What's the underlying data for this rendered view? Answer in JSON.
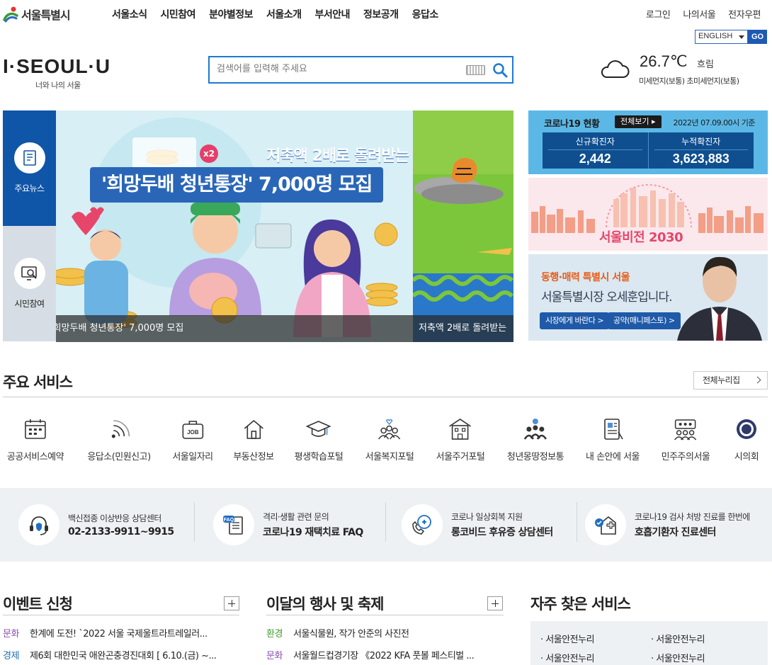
{
  "header": {
    "logo_text": "서울특별시",
    "gnb": [
      "서울소식",
      "시민참여",
      "분야별정보",
      "서울소개",
      "부서안내",
      "정보공개",
      "응답소"
    ],
    "util": [
      "로그인",
      "나의서울",
      "전자우편"
    ],
    "language": {
      "selected": "ENGLISH",
      "go_label": "GO"
    },
    "brand": {
      "main": "I·SEOUL·U",
      "sub": "너와 나의 서울"
    },
    "search": {
      "placeholder": "검색어를 입력해 주세요"
    },
    "weather": {
      "temp": "26.7℃",
      "sky": "흐림",
      "dust": "미세먼지(보통) 초미세먼지(보통)"
    }
  },
  "side_tabs": [
    {
      "label": "주요뉴스",
      "icon": "news-icon",
      "active": true
    },
    {
      "label": "시민참여",
      "icon": "monitor-search-icon",
      "active": false
    }
  ],
  "slides": [
    {
      "caption": "'희망두배 청년통장' 7,000명 모집",
      "headline_1": "저축액 2배로 돌려받는",
      "headline_2": "'희망두배 청년통장' 7,000명 모집",
      "badge": "x2"
    },
    {
      "caption": "저축액 2배로 돌려받는"
    }
  ],
  "covid": {
    "title": "코로나19 현황",
    "view_all": "전체보기 ▸",
    "date": "2022년 07.09.00시 기준",
    "new_label": "신규확진자",
    "new_value": "2,442",
    "total_label": "누적확진자",
    "total_value": "3,623,883"
  },
  "vision": {
    "label": "서울비전 2030"
  },
  "mayor": {
    "tagline": "동행·매력 특별시 서울",
    "title": "서울특별시장 오세훈입니다.",
    "btn1": "시장에게 바란다 >",
    "btn2": "공약(매니페스토) >"
  },
  "services": {
    "title": "주요 서비스",
    "all_label": "전체누리집",
    "items": [
      {
        "label": "공공서비스예약",
        "icon": "calendar-icon"
      },
      {
        "label": "응답소(민원신고)",
        "icon": "signal-icon"
      },
      {
        "label": "서울일자리",
        "icon": "job-bag-icon"
      },
      {
        "label": "부동산정보",
        "icon": "house-icon"
      },
      {
        "label": "평생학습포털",
        "icon": "graduation-cap-icon"
      },
      {
        "label": "서울복지포털",
        "icon": "people-heart-icon"
      },
      {
        "label": "서울주거포털",
        "icon": "apartment-icon"
      },
      {
        "label": "청년몽땅정보통",
        "icon": "youth-info-icon"
      },
      {
        "label": "내 손안에 서울",
        "icon": "mobile-news-icon"
      },
      {
        "label": "민주주의서울",
        "icon": "people-meeting-icon"
      },
      {
        "label": "시의회",
        "icon": "council-emblem-icon"
      }
    ]
  },
  "info_band": [
    {
      "line1": "백신접종 이상반응 상담센터",
      "line2": "02-2133-9911~9915",
      "icon": "headset-shield-icon"
    },
    {
      "line1": "격리·생활 관련 문의",
      "line2": "코로나19 재택치료 FAQ",
      "icon": "faq-document-icon"
    },
    {
      "line1": "코로나 일상회복 지원",
      "line2": "롱코비드 후유증 상담센터",
      "icon": "phone-medical-icon"
    },
    {
      "line1": "코로나19 검사 처방 진료를 한번에",
      "line2": "호흡기환자 진료센터",
      "icon": "clinic-check-icon"
    }
  ],
  "events": {
    "title": "이벤트 신청",
    "rows": [
      {
        "cat": "문화",
        "title": "한계에 도전! `2022 서울 국제울트라트레일러...",
        "cat_color": "#8a4fb3"
      },
      {
        "cat": "경제",
        "title": "제6회 대한민국 애완곤충경진대회 [ 6.10.(금) ~...",
        "cat_color": "#1d6fb3"
      }
    ]
  },
  "festivals": {
    "title": "이달의 행사 및 축제",
    "rows": [
      {
        "cat": "환경",
        "title": "서울식물원, 작가 안준의 사진전",
        "cat_color": "#3f9a2d"
      },
      {
        "cat": "문화",
        "title": "서울월드컵경기장 《2022 KFA 풋볼 페스티벌 ...",
        "cat_color": "#8a4fb3"
      }
    ]
  },
  "frequent": {
    "title": "자주 찾은 서비스",
    "items": [
      "· 서울안전누리",
      "· 서울안전누리",
      "· 서울안전누리",
      "· 서울안전누리"
    ]
  }
}
